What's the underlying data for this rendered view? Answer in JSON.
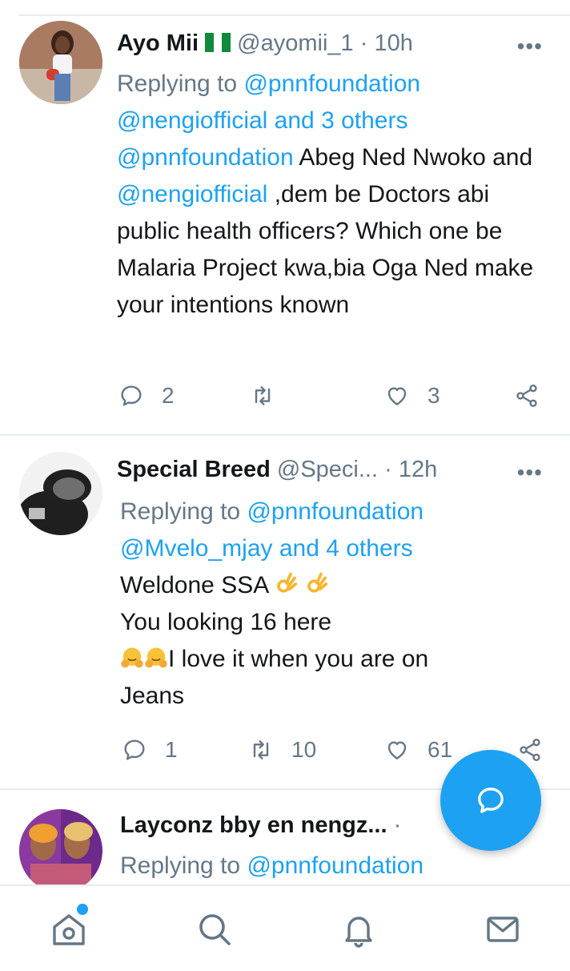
{
  "tweets": [
    {
      "name": "Ayo Mii",
      "handle_time": "@ayomii_1 · 10h",
      "replying_prefix": "Replying to",
      "replying_first": "@pnnfoundation",
      "replying_rest": "@nengiofficial and 3 others",
      "body_mention1": "@pnnfoundation",
      "body_text1": " Abeg Ned Nwoko and ",
      "body_mention2": "@nengiofficial",
      "body_text2": " ,dem be Doctors abi public health officers? Which one be Malaria Project kwa,bia Oga Ned make your intentions known",
      "reply_count": "2",
      "retweet_count": "",
      "like_count": "3"
    },
    {
      "name": "Special Breed",
      "handle_time": "@Speci... · 12h",
      "replying_prefix": "Replying to",
      "replying_first": "@pnnfoundation",
      "replying_rest": "@Mvelo_mjay and 4 others",
      "line1": "Weldone SSA",
      "line2": "You looking 16 here",
      "line3": "I love it when you are on",
      "line4": "Jeans",
      "reply_count": "1",
      "retweet_count": "10",
      "like_count": "61"
    },
    {
      "name": "Layconz bby en nengz...",
      "handle_time": "·",
      "replying_prefix": "Replying to",
      "replying_first": "@pnnfoundation"
    }
  ],
  "icons": {
    "reply": "reply-icon",
    "retweet": "retweet-icon",
    "like": "heart-icon",
    "share": "share-icon",
    "compose": "compose-reply-icon",
    "home": "home-icon",
    "search": "search-icon",
    "notifications": "bell-icon",
    "messages": "mail-icon"
  },
  "colors": {
    "accent": "#1da1f2",
    "muted": "#657786",
    "text": "#14171a",
    "divider": "#e6ecf0"
  }
}
